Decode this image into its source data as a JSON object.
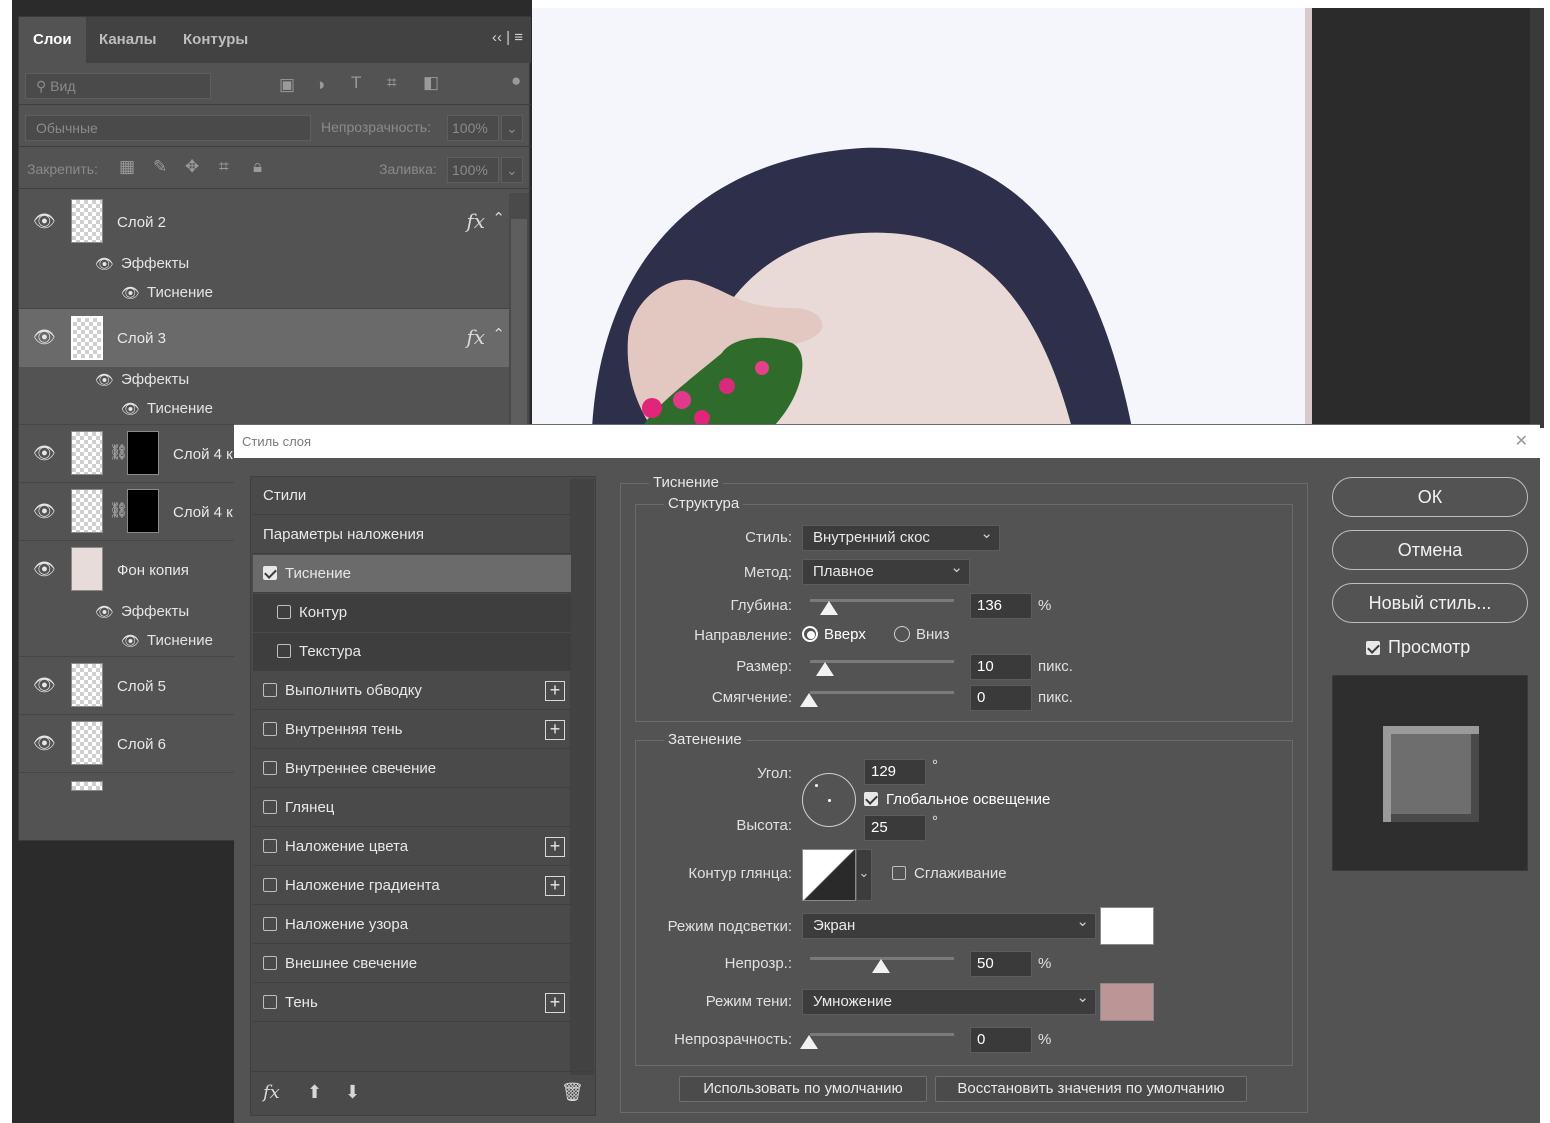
{
  "layers_panel": {
    "tabs": [
      "Слои",
      "Каналы",
      "Контуры"
    ],
    "menu_glyph": "‹‹ | ≡",
    "search_placeholder": "Вид",
    "blend_mode": "Обычные",
    "opacity_label": "Непрозрачность:",
    "opacity_value": "100%",
    "lock_label": "Закрепить:",
    "fill_label": "Заливка:",
    "fill_value": "100%",
    "effects_label": "Эффекты",
    "emboss_label": "Тиснение",
    "fx_glyph": "fx",
    "layers": [
      {
        "name": "Слой 2",
        "has_fx": true
      },
      {
        "name": "Слой 3",
        "has_fx": true,
        "selected": true
      },
      {
        "name": "Слой 4 к",
        "has_mask": true
      },
      {
        "name": "Слой 4 к",
        "has_mask": true
      },
      {
        "name": "Фон копия"
      },
      {
        "name": "Слой 5"
      },
      {
        "name": "Слой 6"
      }
    ]
  },
  "dialog": {
    "title": "Стиль слоя",
    "styles_list": [
      {
        "label": "Стили",
        "checkbox": false
      },
      {
        "label": "Параметры наложения",
        "checkbox": false
      },
      {
        "label": "Тиснение",
        "checkbox": true,
        "checked": true,
        "selected": true
      },
      {
        "label": "Контур",
        "checkbox": true,
        "checked": false,
        "child": true
      },
      {
        "label": "Текстура",
        "checkbox": true,
        "checked": false,
        "child": true
      },
      {
        "label": "Выполнить обводку",
        "checkbox": true,
        "checked": false,
        "plus": true
      },
      {
        "label": "Внутренняя тень",
        "checkbox": true,
        "checked": false,
        "plus": true
      },
      {
        "label": "Внутреннее свечение",
        "checkbox": true,
        "checked": false
      },
      {
        "label": "Глянец",
        "checkbox": true,
        "checked": false
      },
      {
        "label": "Наложение цвета",
        "checkbox": true,
        "checked": false,
        "plus": true
      },
      {
        "label": "Наложение градиента",
        "checkbox": true,
        "checked": false,
        "plus": true
      },
      {
        "label": "Наложение узора",
        "checkbox": true,
        "checked": false
      },
      {
        "label": "Внешнее свечение",
        "checkbox": true,
        "checked": false
      },
      {
        "label": "Тень",
        "checkbox": true,
        "checked": false,
        "plus": true
      }
    ],
    "section_title": "Тиснение",
    "structure": {
      "title": "Структура",
      "style_label": "Стиль:",
      "style_value": "Внутренний скос",
      "method_label": "Метод:",
      "method_value": "Плавное",
      "depth_label": "Глубина:",
      "depth_value": "136",
      "depth_unit": "%",
      "direction_label": "Направление:",
      "dir_up": "Вверх",
      "dir_down": "Вниз",
      "size_label": "Размер:",
      "size_value": "10",
      "size_unit": "пикс.",
      "soften_label": "Смягчение:",
      "soften_value": "0",
      "soften_unit": "пикс."
    },
    "shading": {
      "title": "Затенение",
      "angle_label": "Угол:",
      "angle_value": "129",
      "degree": "°",
      "global_light": "Глобальное освещение",
      "altitude_label": "Высота:",
      "altitude_value": "25",
      "gloss_label": "Контур глянца:",
      "antialias": "Сглаживание",
      "highlight_label": "Режим подсветки:",
      "highlight_value": "Экран",
      "highlight_color": "#ffffff",
      "hl_opacity_label": "Непрозр.:",
      "hl_opacity_value": "50",
      "percent": "%",
      "shadow_label": "Режим тени:",
      "shadow_value": "Умножение",
      "shadow_color": "#bc9597",
      "sh_opacity_label": "Непрозрачность:",
      "sh_opacity_value": "0"
    },
    "make_default": "Использовать по умолчанию",
    "reset_default": "Восстановить значения по умолчанию",
    "ok": "ОК",
    "cancel": "Отмена",
    "new_style": "Новый стиль...",
    "preview": "Просмотр"
  }
}
